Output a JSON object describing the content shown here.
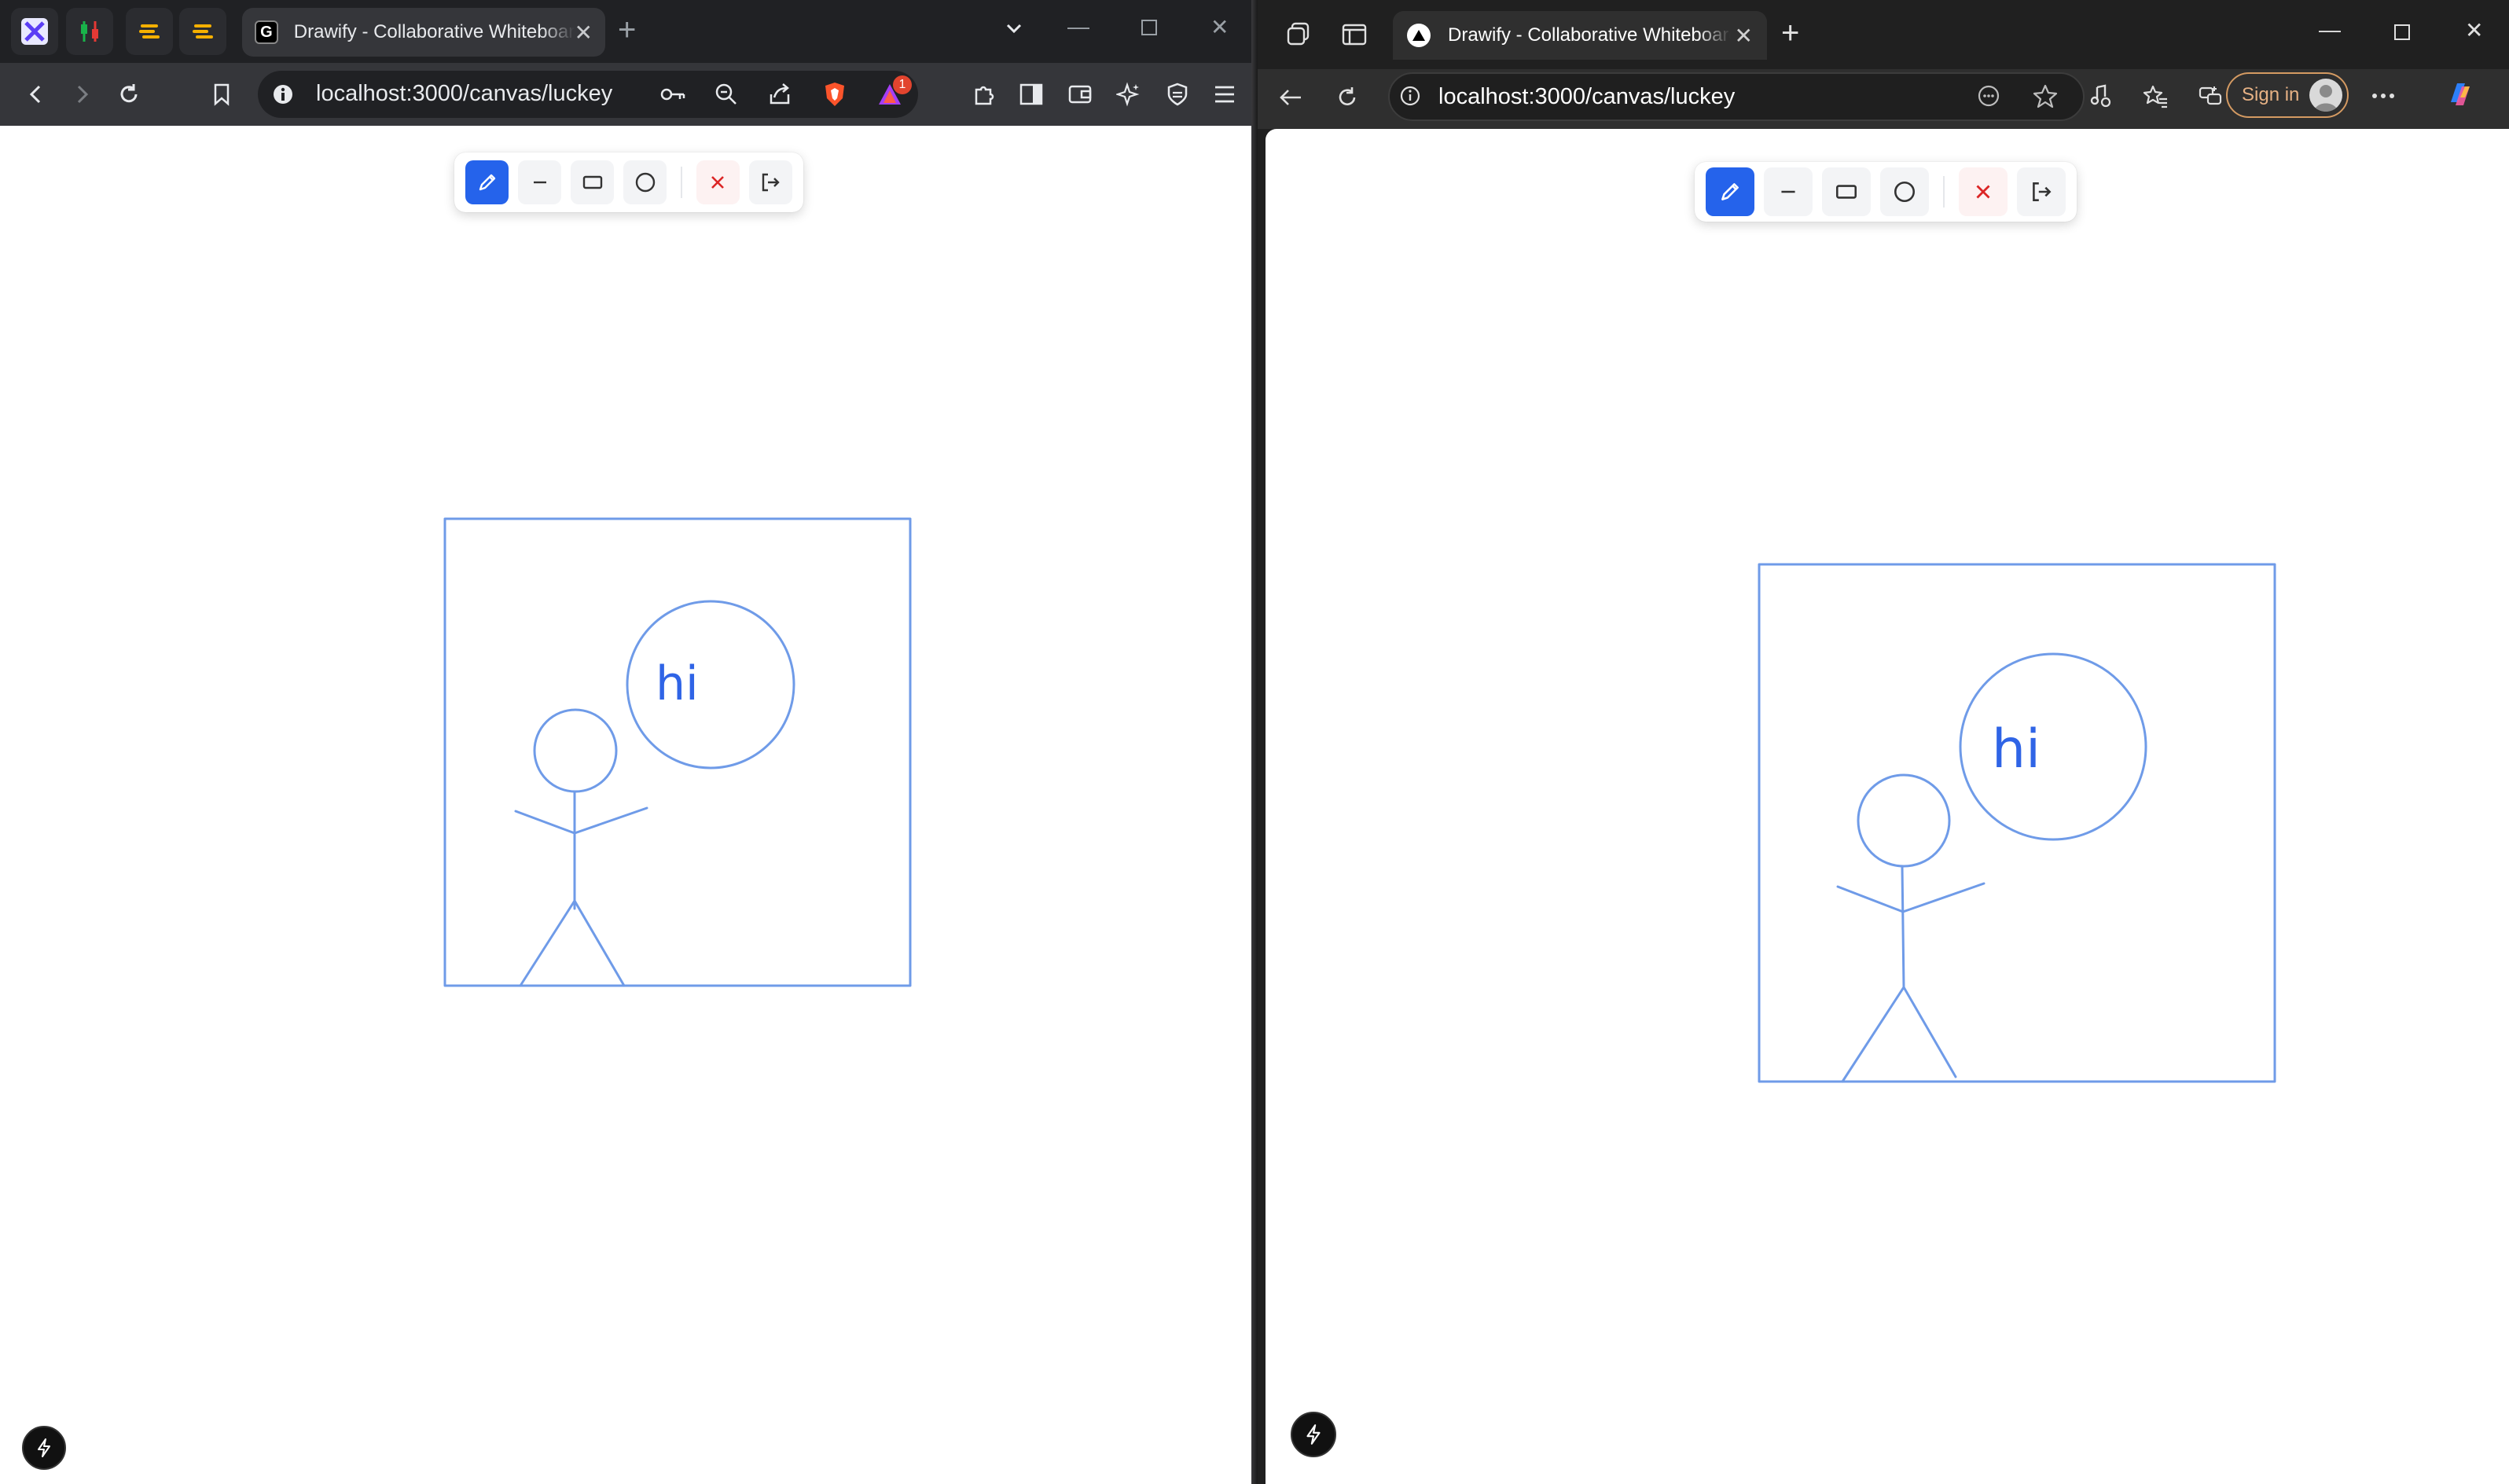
{
  "left_browser": {
    "tab_title": "Drawify - Collaborative Whiteboard",
    "tab_favicon": "G",
    "url": "localhost:3000/canvas/luckey",
    "notification_count": "1"
  },
  "right_browser": {
    "tab_title": "Drawify - Collaborative Whiteboard",
    "url": "localhost:3000/canvas/luckey",
    "sign_in_label": "Sign in"
  },
  "drawify": {
    "tools": [
      "pencil",
      "line",
      "rectangle",
      "circle",
      "clear",
      "exit"
    ],
    "active_tool": "pencil",
    "canvas_text": "hi",
    "stroke_color": "#6f9be8",
    "accent_color": "#2563eb",
    "clear_color": "#dc2626"
  }
}
